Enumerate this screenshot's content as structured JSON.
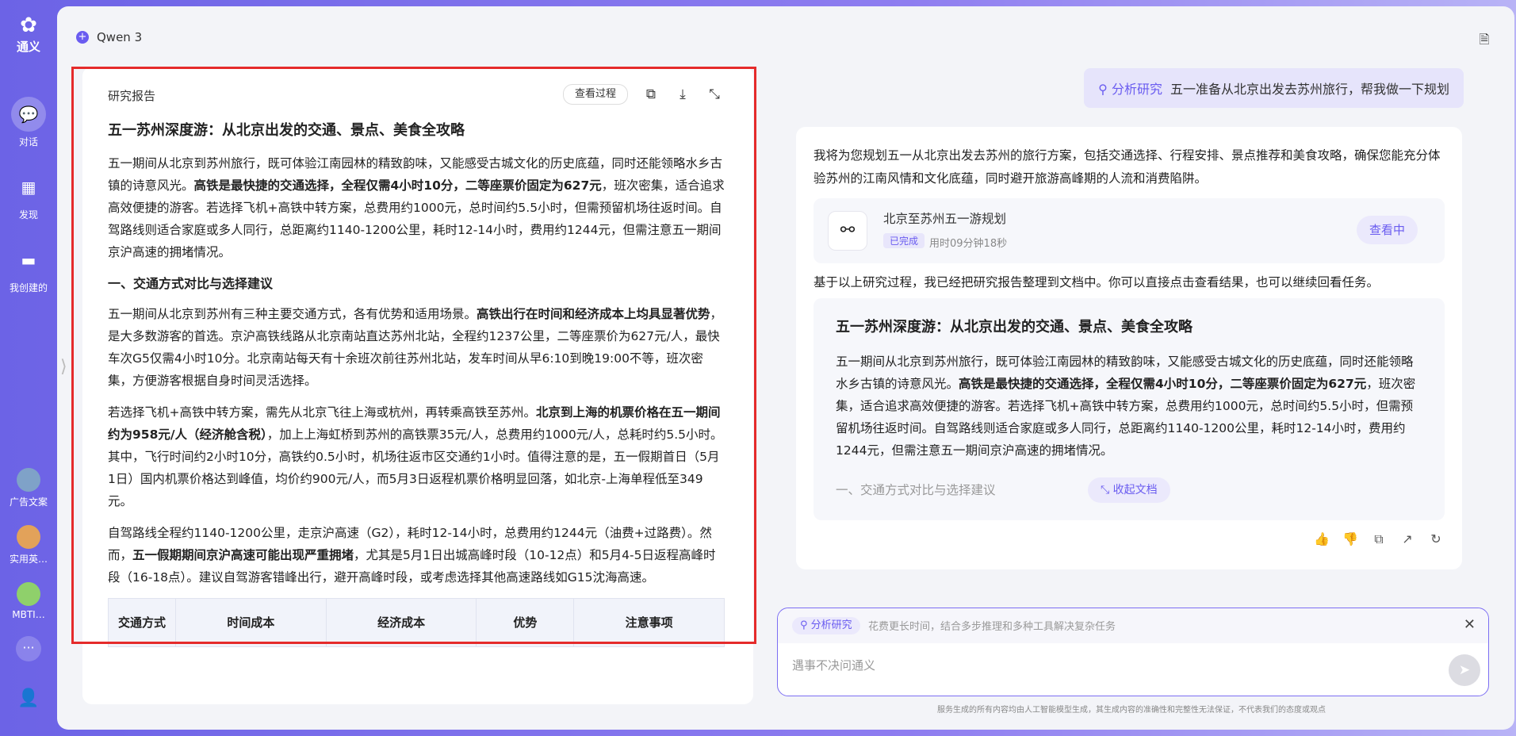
{
  "rail": {
    "logo_text": "通义",
    "items": [
      {
        "label": "对话",
        "icon": "chat-icon"
      },
      {
        "label": "发现",
        "icon": "grid-icon"
      },
      {
        "label": "我创建的",
        "icon": "folder-icon"
      }
    ],
    "agents": [
      {
        "label": "广告文案"
      },
      {
        "label": "实用英…"
      },
      {
        "label": "MBTI…"
      }
    ],
    "more": "···"
  },
  "header": {
    "model": "Qwen 3"
  },
  "report": {
    "panel_title": "研究报告",
    "view_process": "查看过程",
    "h1": "五一苏州深度游：从北京出发的交通、景点、美食全攻略",
    "p1_a": "五一期间从北京到苏州旅行，既可体验江南园林的精致韵味，又能感受古城文化的历史底蕴，同时还能领略水乡古镇的诗意风光。",
    "p1_b": "高铁是最快捷的交通选择，全程仅需4小时10分，二等座票价固定为627元",
    "p1_c": "，班次密集，适合追求高效便捷的游客。若选择飞机+高铁中转方案，总费用约1000元，总时间约5.5小时，但需预留机场往返时间。自驾路线则适合家庭或多人同行，总距离约1140-1200公里，耗时12-14小时，费用约1244元，但需注意五一期间京沪高速的拥堵情况。",
    "h2": "一、交通方式对比与选择建议",
    "p2_a": "五一期间从北京到苏州有三种主要交通方式，各有优势和适用场景。",
    "p2_b": "高铁出行在时间和经济成本上均具显著优势",
    "p2_c": "，是大多数游客的首选。京沪高铁线路从北京南站直达苏州北站，全程约1237公里，二等座票价为627元/人，最快车次G5仅需4小时10分。北京南站每天有十余班次前往苏州北站，发车时间从早6:10到晚19:00不等，班次密集，方便游客根据自身时间灵活选择。",
    "p3_a": "若选择飞机+高铁中转方案，需先从北京飞往上海或杭州，再转乘高铁至苏州。",
    "p3_b": "北京到上海的机票价格在五一期间约为958元/人（经济舱含税）",
    "p3_c": "，加上上海虹桥到苏州的高铁票35元/人，总费用约1000元/人，总耗时约5.5小时。其中，飞行时间约2小时10分，高铁约0.5小时，机场往返市区交通约1小时。值得注意的是，五一假期首日（5月1日）国内机票价格达到峰值，均价约900元/人，而5月3日返程机票价格明显回落，如北京-上海单程低至349元。",
    "p4_a": "自驾路线全程约1140-1200公里，走京沪高速（G2），耗时12-14小时，总费用约1244元（油费+过路费）。然而，",
    "p4_b": "五一假期期间京沪高速可能出现严重拥堵",
    "p4_c": "，尤其是5月1日出城高峰时段（10-12点）和5月4-5日返程高峰时段（16-18点）。建议自驾游客错峰出行，避开高峰时段，或考虑选择其他高速路线如G15沈海高速。",
    "table_headers": [
      "交通方式",
      "时间成本",
      "经济成本",
      "优势",
      "注意事项"
    ]
  },
  "chat": {
    "user_tag": "分析研究",
    "user_msg": "五一准备从北京出发去苏州旅行，帮我做一下规划",
    "intro": "我将为您规划五一从北京出发去苏州的旅行方案，包括交通选择、行程安排、景点推荐和美食攻略，确保您能充分体验苏州的江南风情和文化底蕴，同时避开旅游高峰期的人流和消费陷阱。",
    "task_title": "北京至苏州五一游规划",
    "task_status": "已完成",
    "task_time": "用时09分钟18秒",
    "task_viewing": "查看中",
    "after": "基于以上研究过程，我已经把研究报告整理到文档中。你可以直接点击查看结果，也可以继续回看任务。",
    "preview_title": "五一苏州深度游：从北京出发的交通、景点、美食全攻略",
    "preview_a": "五一期间从北京到苏州旅行，既可体验江南园林的精致韵味，又能感受古城文化的历史底蕴，同时还能领略水乡古镇的诗意风光。",
    "preview_b": "高铁是最快捷的交通选择，全程仅需4小时10分，二等座票价固定为627元",
    "preview_c": "，班次密集，适合追求高效便捷的游客。若选择飞机+高铁中转方案，总费用约1000元，总时间约5.5小时，但需预留机场往返时间。自驾路线则适合家庭或多人同行，总距离约1140-1200公里，耗时12-14小时，费用约1244元，但需注意五一期间京沪高速的拥堵情况。",
    "preview_section": "一、交通方式对比与选择建议",
    "collapse": "收起文档"
  },
  "input": {
    "mode": "分析研究",
    "mode_desc": "花费更长时间，结合多步推理和多种工具解决复杂任务",
    "placeholder": "遇事不决问通义"
  },
  "footnote": "服务生成的所有内容均由人工智能模型生成，其生成内容的准确性和完整性无法保证，不代表我们的态度或观点"
}
